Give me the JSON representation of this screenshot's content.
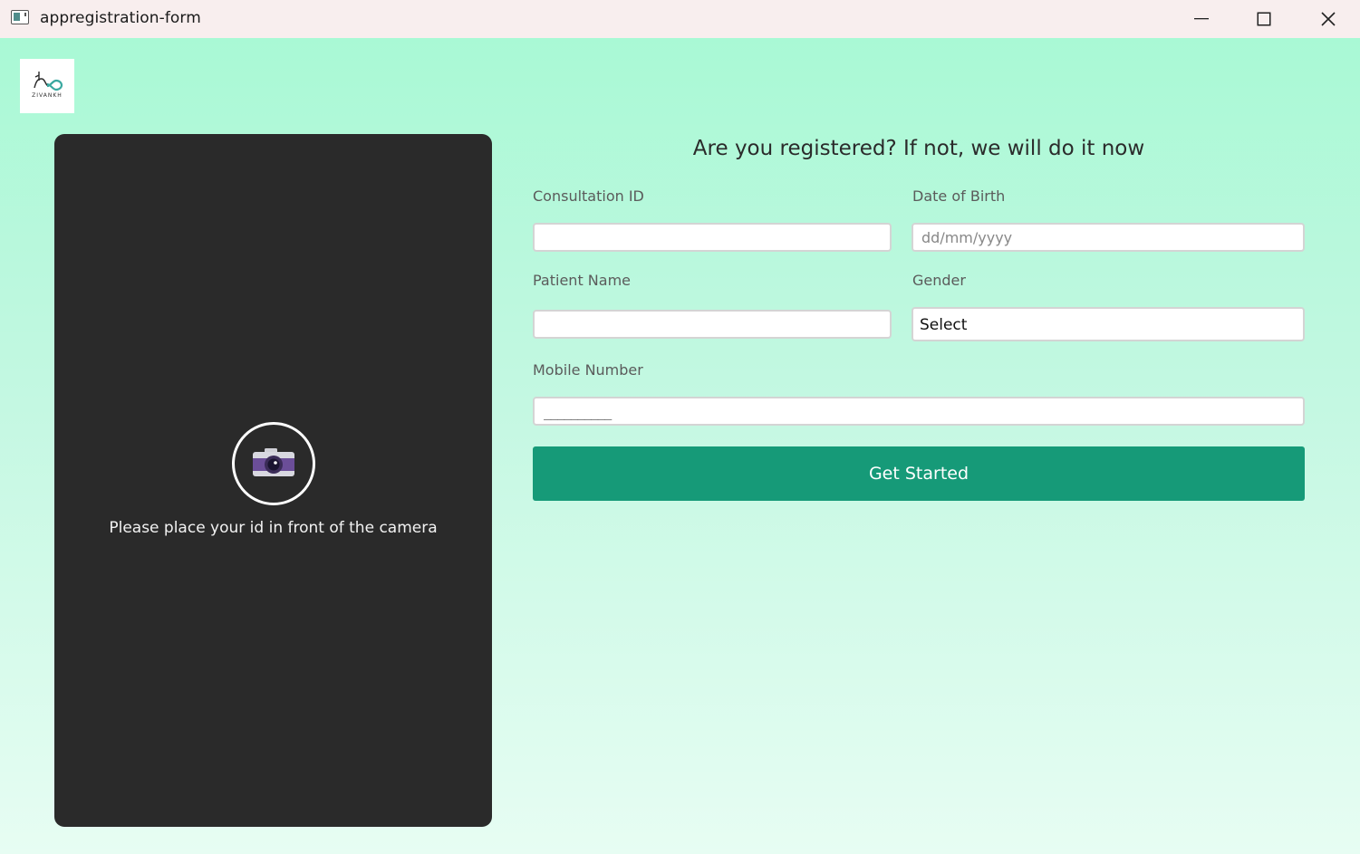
{
  "window": {
    "title": "appregistration-form",
    "app_icon": "app-window-icon",
    "controls": [
      "minimize-icon",
      "maximize-icon",
      "close-icon"
    ]
  },
  "logo": {
    "text": "ZIVANKH",
    "icon": "hand-infinity-logo"
  },
  "camera_panel": {
    "icon": "camera-icon",
    "message": "Please place your id in front of the camera"
  },
  "form": {
    "title": "Are you registered? If not, we will do it now",
    "consultation_id": {
      "label": "Consultation ID",
      "value": ""
    },
    "date_of_birth": {
      "label": "Date of Birth",
      "value": "",
      "placeholder": "dd/mm/yyyy"
    },
    "patient_name": {
      "label": "Patient Name",
      "value": ""
    },
    "gender": {
      "label": "Gender",
      "selected": "Select"
    },
    "mobile_number": {
      "label": "Mobile Number",
      "mask": "__________"
    },
    "submit_label": "Get Started"
  },
  "colors": {
    "titlebar": "#f8eeee",
    "background_top": "#a9f9d5",
    "background_bottom": "#e7fdf3",
    "panel": "#2a2a2a",
    "accent": "#169a78"
  }
}
